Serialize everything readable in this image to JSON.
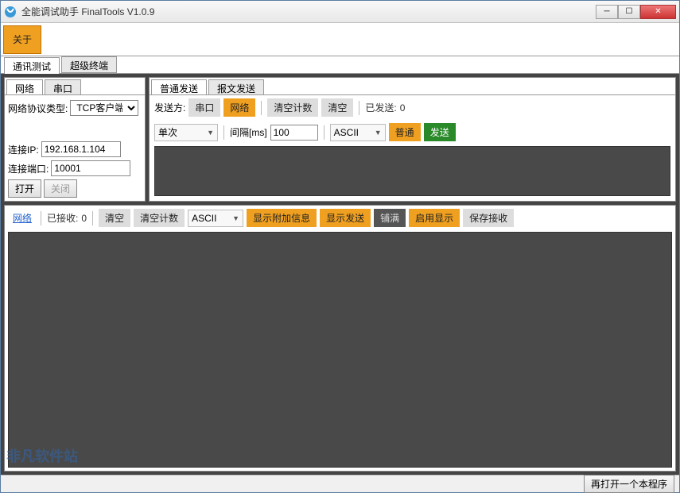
{
  "window": {
    "title": "全能调试助手 FinalTools V1.0.9",
    "about_label": "关于"
  },
  "maintabs": {
    "comm": "通讯测试",
    "term": "超级终端"
  },
  "left": {
    "tab_net": "网络",
    "tab_serial": "串口",
    "proto_label": "网络协议类型:",
    "proto_value": "TCP客户端",
    "ip_label": "连接IP:",
    "ip_value": "192.168.1.104",
    "port_label": "连接端口:",
    "port_value": "10001",
    "open": "打开",
    "close": "关闭"
  },
  "send": {
    "tab_normal": "普通发送",
    "tab_packet": "报文发送",
    "sender_label": "发送方:",
    "serial_btn": "串口",
    "net_btn": "网络",
    "clear_count": "清空计数",
    "clear": "清空",
    "sent_label": "已发送:",
    "sent_value": "0",
    "mode_value": "单次",
    "interval_label": "间隔[ms]",
    "interval_value": "100",
    "format_value": "ASCII",
    "normal_btn": "普通",
    "send_btn": "发送"
  },
  "recv": {
    "net_link": "网络",
    "received_label": "已接收:",
    "received_value": "0",
    "clear": "清空",
    "clear_count": "清空计数",
    "format_value": "ASCII",
    "show_extra": "显示附加信息",
    "show_send": "显示发送",
    "fill": "铺满",
    "enable_disp": "启用显示",
    "save_recv": "保存接收"
  },
  "status": {
    "reopen": "再打开一个本程序"
  },
  "watermark": "非凡软件站"
}
